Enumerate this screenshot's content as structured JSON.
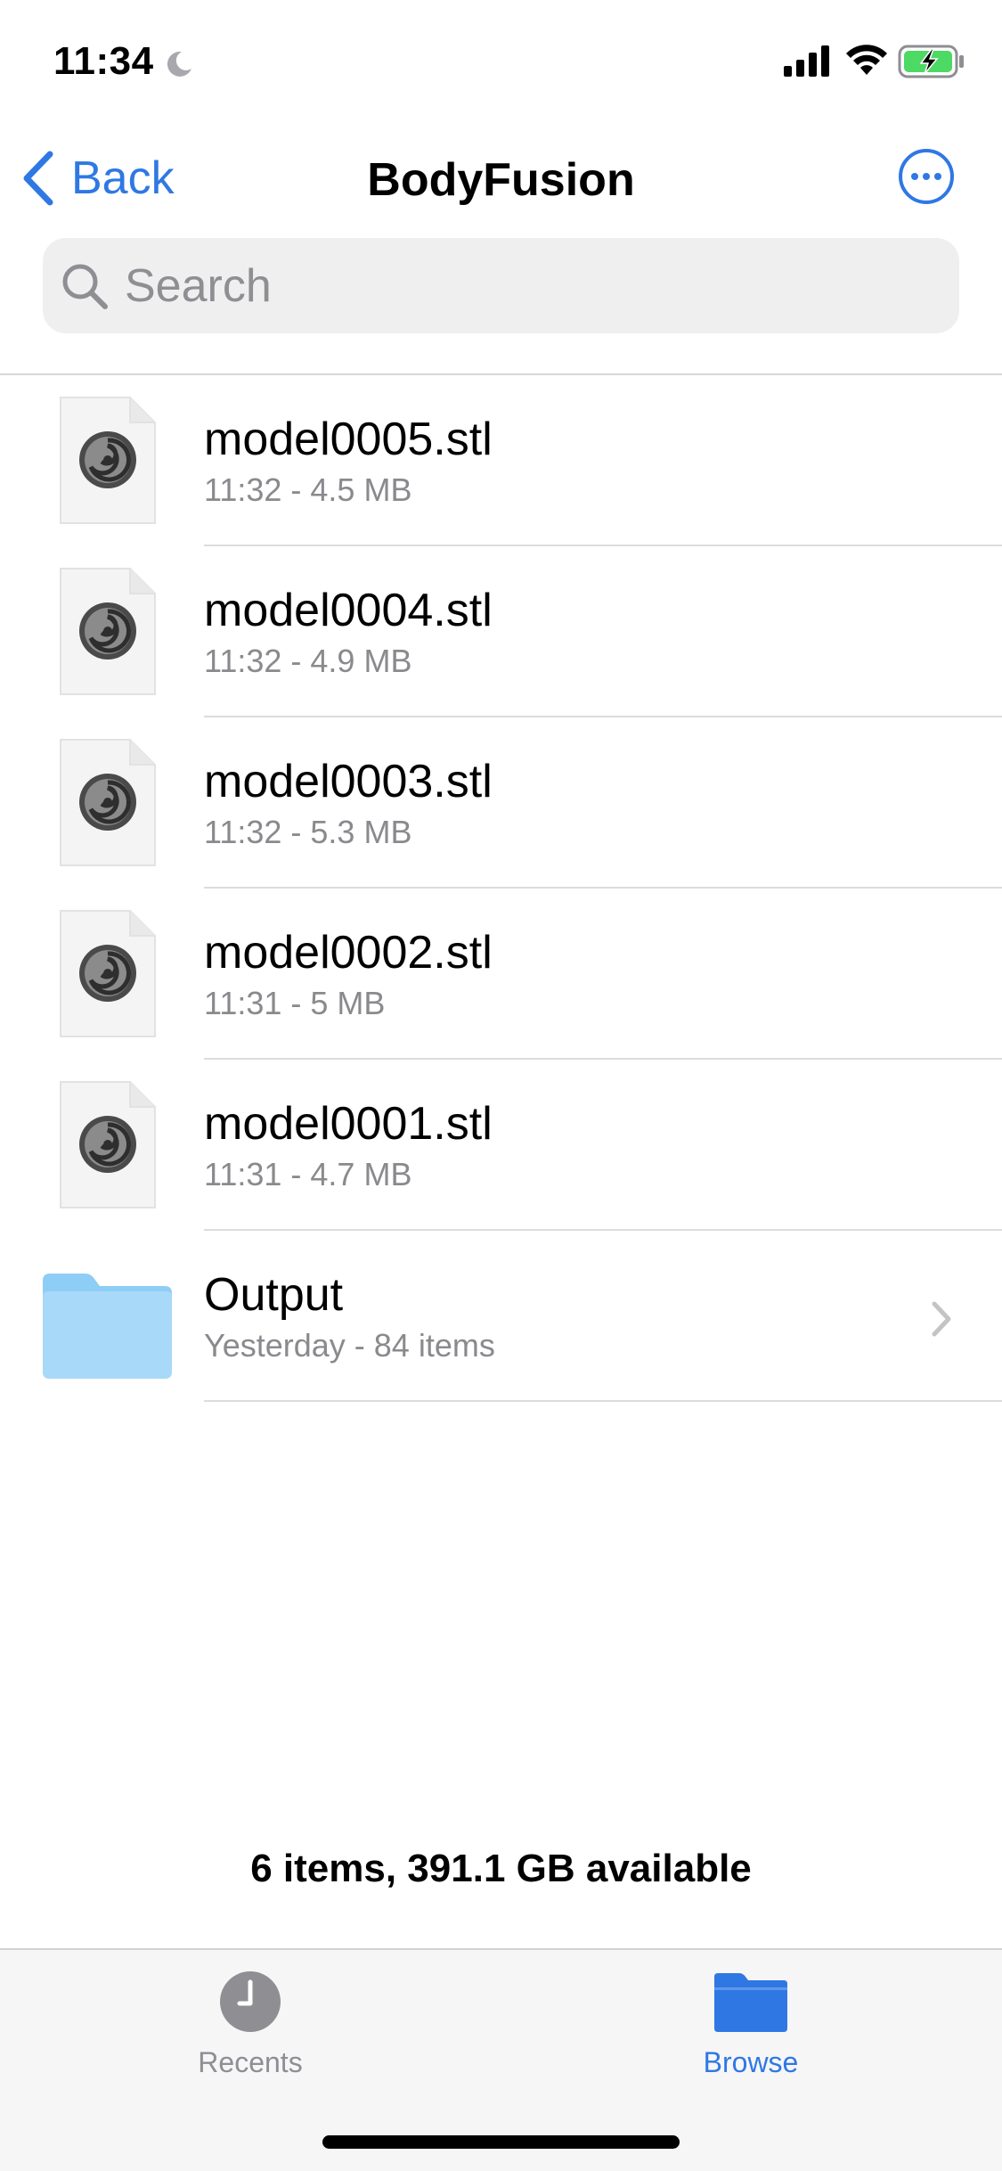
{
  "status_bar": {
    "time": "11:34"
  },
  "nav": {
    "back_label": "Back",
    "title": "BodyFusion"
  },
  "search": {
    "placeholder": "Search"
  },
  "files": [
    {
      "name": "model0005.stl",
      "meta": "11:32 - 4.5 MB",
      "icon": "stl-file-icon"
    },
    {
      "name": "model0004.stl",
      "meta": "11:32 - 4.9 MB",
      "icon": "stl-file-icon"
    },
    {
      "name": "model0003.stl",
      "meta": "11:32 - 5.3 MB",
      "icon": "stl-file-icon"
    },
    {
      "name": "model0002.stl",
      "meta": "11:31 - 5 MB",
      "icon": "stl-file-icon"
    },
    {
      "name": "model0001.stl",
      "meta": "11:31 - 4.7 MB",
      "icon": "stl-file-icon"
    }
  ],
  "folder": {
    "name": "Output",
    "meta": "Yesterday - 84 items",
    "icon": "folder-icon"
  },
  "summary": "6 items, 391.1 GB available",
  "tabs": [
    {
      "label": "Recents",
      "icon": "clock-icon",
      "active": false
    },
    {
      "label": "Browse",
      "icon": "folder-icon",
      "active": true
    }
  ],
  "colors": {
    "accent": "#2f78e4",
    "secondary_text": "#8a8a8e",
    "folder": "#8ecdf5",
    "battery_charge": "#4cd964"
  }
}
